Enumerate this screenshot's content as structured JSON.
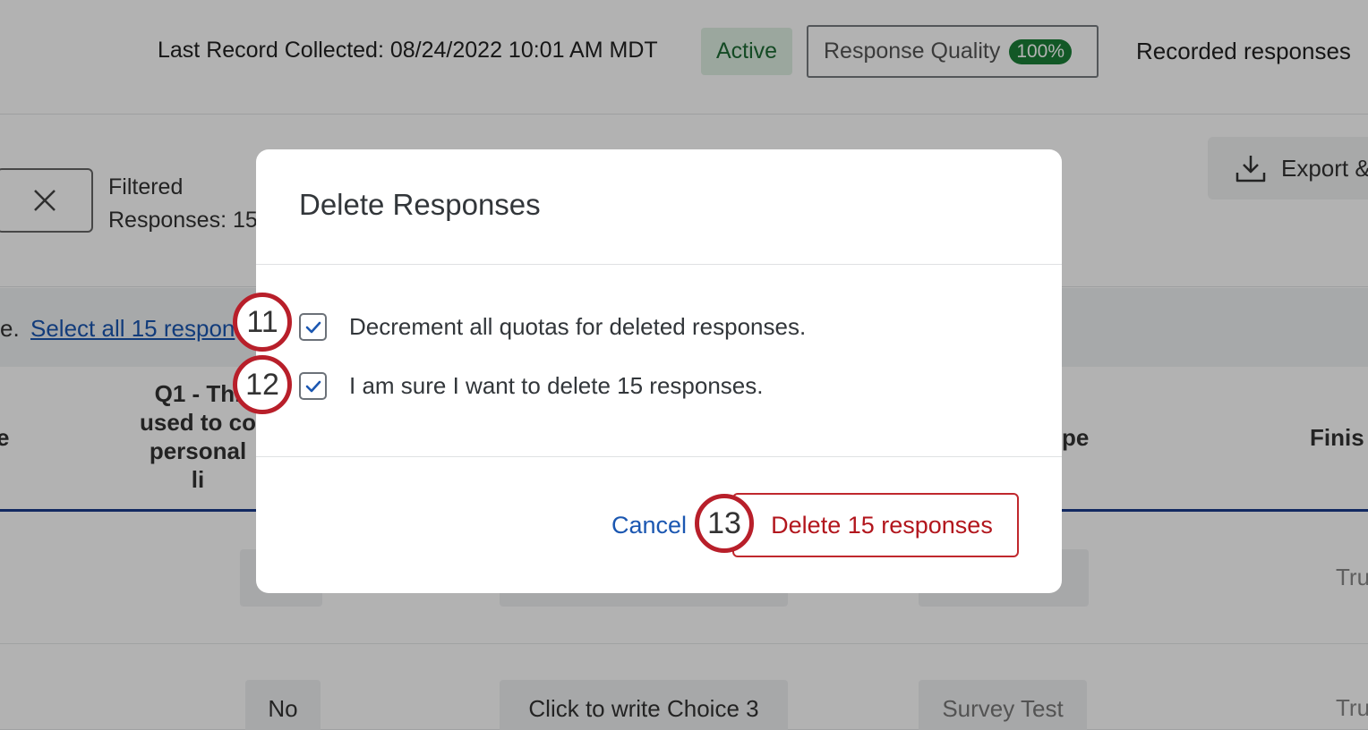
{
  "header": {
    "last_record": "Last Record Collected: 08/24/2022 10:01 AM MDT",
    "status_badge": "Active",
    "response_quality_label": "Response Quality",
    "response_quality_value": "100%",
    "recorded_responses": "Recorded responses"
  },
  "toolbar": {
    "filtered_line1": "Filtered",
    "filtered_line2": "Responses: 15",
    "export_label": "Export &"
  },
  "selection": {
    "prefix": "e.",
    "select_all_link": "Select all 15 respon"
  },
  "table": {
    "columns": {
      "left_partial": "e",
      "q1_lines": [
        "Q1 - Thi",
        "used to co",
        "personal",
        "li"
      ],
      "type_partial": "pe",
      "finished_partial": "Finis"
    },
    "rows": [
      {
        "answer": "",
        "choice": "",
        "type": "",
        "finished": "Tru"
      },
      {
        "answer": "No",
        "choice": "Click to write Choice 3",
        "type": "Survey Test",
        "finished": "Tru"
      }
    ]
  },
  "modal": {
    "title": "Delete Responses",
    "options": [
      {
        "label": "Decrement all quotas for deleted responses.",
        "checked": true
      },
      {
        "label": "I am sure I want to delete 15 responses.",
        "checked": true
      }
    ],
    "cancel_label": "Cancel",
    "delete_label": "Delete 15 responses"
  },
  "markers": [
    "11",
    "12",
    "13"
  ],
  "colors": {
    "accent_blue": "#1b57b1",
    "danger_red": "#b2161d",
    "marker_red": "#b81f2a",
    "success_green": "#1a7f37"
  },
  "icons": {
    "clear_filter": "close-icon",
    "export": "download-icon",
    "checkbox": "check-icon"
  }
}
